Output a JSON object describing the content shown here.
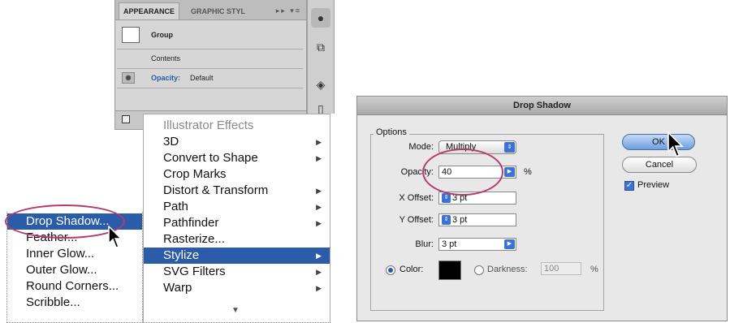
{
  "appearance_panel": {
    "tabs": [
      "APPEARANCE",
      "GRAPHIC STYL"
    ],
    "tab_controls": "▸▸ ▾≡",
    "rows": {
      "group": "Group",
      "contents": "Contents",
      "opacity_label": "Opacity:",
      "opacity_value": "Default"
    }
  },
  "effect_menu": {
    "header": "Illustrator Effects",
    "items": [
      {
        "label": "3D",
        "submenu": true
      },
      {
        "label": "Convert to Shape",
        "submenu": true
      },
      {
        "label": "Crop Marks",
        "submenu": false
      },
      {
        "label": "Distort & Transform",
        "submenu": true
      },
      {
        "label": "Path",
        "submenu": true
      },
      {
        "label": "Pathfinder",
        "submenu": true
      },
      {
        "label": "Rasterize...",
        "submenu": false
      },
      {
        "label": "Stylize",
        "submenu": true,
        "selected": true
      },
      {
        "label": "SVG Filters",
        "submenu": true
      },
      {
        "label": "Warp",
        "submenu": true
      }
    ]
  },
  "stylize_submenu": {
    "items": [
      {
        "label": "Drop Shadow...",
        "selected": true
      },
      {
        "label": "Feather..."
      },
      {
        "label": "Inner Glow..."
      },
      {
        "label": "Outer Glow..."
      },
      {
        "label": "Round Corners..."
      },
      {
        "label": "Scribble..."
      }
    ]
  },
  "dialog": {
    "title": "Drop Shadow",
    "group_title": "Options",
    "mode_label": "Mode:",
    "mode_value": "Multiply",
    "opacity_label": "Opacity:",
    "opacity_value": "40",
    "opacity_unit": "%",
    "x_offset_label": "X Offset:",
    "x_offset_value": "3 pt",
    "y_offset_label": "Y Offset:",
    "y_offset_value": "3 pt",
    "blur_label": "Blur:",
    "blur_value": "3 pt",
    "color_label": "Color:",
    "darkness_label": "Darkness:",
    "darkness_value": "100",
    "darkness_unit": "%",
    "ok_label": "OK",
    "cancel_label": "Cancel",
    "preview_label": "Preview",
    "preview_checked": true,
    "shadow_color": "#000000"
  },
  "colors": {
    "highlight": "#2a5caa",
    "annotation": "#b83a6c"
  }
}
